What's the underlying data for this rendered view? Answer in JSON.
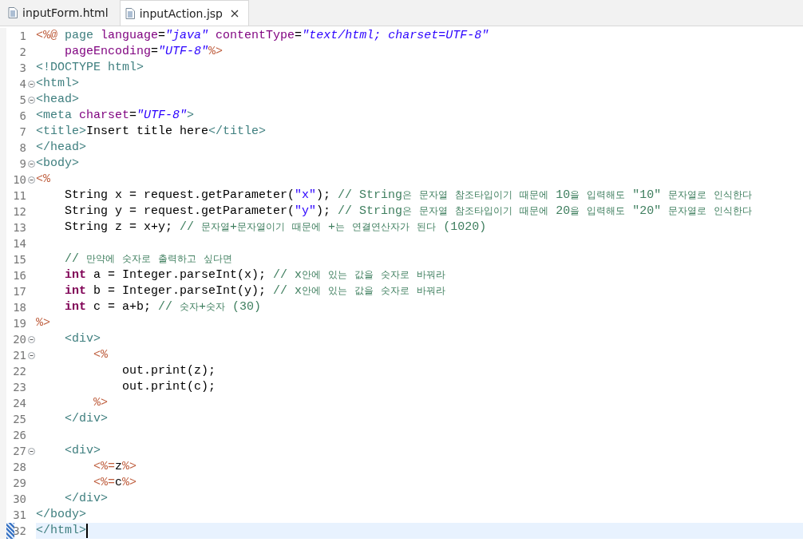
{
  "tabs": [
    {
      "label": "inputForm.html",
      "selected": false,
      "closable": false
    },
    {
      "label": "inputAction.jsp",
      "selected": true,
      "closable": true
    }
  ],
  "lines": [
    {
      "number": "1",
      "foldable": false,
      "current": false,
      "marked": false,
      "tokens": [
        {
          "kind": "jsp",
          "text": "<%@"
        },
        {
          "kind": "tag",
          "text": " page"
        },
        {
          "kind": "attr",
          "text": " language"
        },
        {
          "kind": "plain",
          "text": "="
        },
        {
          "kind": "value",
          "text": "\"java\""
        },
        {
          "kind": "attr",
          "text": " contentType"
        },
        {
          "kind": "plain",
          "text": "="
        },
        {
          "kind": "value",
          "text": "\"text/html; charset=UTF-8\""
        }
      ]
    },
    {
      "number": "2",
      "foldable": false,
      "current": false,
      "marked": false,
      "tokens": [
        {
          "kind": "attr",
          "text": "    pageEncoding"
        },
        {
          "kind": "plain",
          "text": "="
        },
        {
          "kind": "value",
          "text": "\"UTF-8\""
        },
        {
          "kind": "jsp",
          "text": "%>"
        }
      ]
    },
    {
      "number": "3",
      "foldable": false,
      "current": false,
      "marked": false,
      "tokens": [
        {
          "kind": "tag",
          "text": "<!DOCTYPE html>"
        }
      ]
    },
    {
      "number": "4",
      "foldable": true,
      "current": false,
      "marked": false,
      "tokens": [
        {
          "kind": "tag",
          "text": "<html>"
        }
      ]
    },
    {
      "number": "5",
      "foldable": true,
      "current": false,
      "marked": false,
      "tokens": [
        {
          "kind": "tag",
          "text": "<head>"
        }
      ]
    },
    {
      "number": "6",
      "foldable": false,
      "current": false,
      "marked": false,
      "tokens": [
        {
          "kind": "tag",
          "text": "<meta"
        },
        {
          "kind": "attr",
          "text": " charset"
        },
        {
          "kind": "plain",
          "text": "="
        },
        {
          "kind": "value",
          "text": "\"UTF-8\""
        },
        {
          "kind": "tag",
          "text": ">"
        }
      ]
    },
    {
      "number": "7",
      "foldable": false,
      "current": false,
      "marked": false,
      "tokens": [
        {
          "kind": "tag",
          "text": "<title>"
        },
        {
          "kind": "plain",
          "text": "Insert title here"
        },
        {
          "kind": "tag",
          "text": "</title>"
        }
      ]
    },
    {
      "number": "8",
      "foldable": false,
      "current": false,
      "marked": false,
      "tokens": [
        {
          "kind": "tag",
          "text": "</head>"
        }
      ]
    },
    {
      "number": "9",
      "foldable": true,
      "current": false,
      "marked": false,
      "tokens": [
        {
          "kind": "tag",
          "text": "<body>"
        }
      ]
    },
    {
      "number": "10",
      "foldable": true,
      "current": false,
      "marked": false,
      "tokens": [
        {
          "kind": "jsp",
          "text": "<%"
        }
      ]
    },
    {
      "number": "11",
      "foldable": false,
      "current": false,
      "marked": false,
      "tokens": [
        {
          "kind": "plain",
          "text": "    String x = request.getParameter("
        },
        {
          "kind": "string",
          "text": "\"x\""
        },
        {
          "kind": "plain",
          "text": "); "
        },
        {
          "kind": "comment",
          "text": "// String은 문자열 참조타입이기 때문에 10을 입력해도 \"10\" 문자열로 인식한다"
        }
      ]
    },
    {
      "number": "12",
      "foldable": false,
      "current": false,
      "marked": false,
      "tokens": [
        {
          "kind": "plain",
          "text": "    String y = request.getParameter("
        },
        {
          "kind": "string",
          "text": "\"y\""
        },
        {
          "kind": "plain",
          "text": "); "
        },
        {
          "kind": "comment",
          "text": "// String은 문자열 참조타입이기 때문에 20을 입력해도 \"20\" 문자열로 인식한다"
        }
      ]
    },
    {
      "number": "13",
      "foldable": false,
      "current": false,
      "marked": false,
      "tokens": [
        {
          "kind": "plain",
          "text": "    String z = x+y; "
        },
        {
          "kind": "comment",
          "text": "// 문자열+문자열이기 때문에 +는 연결연산자가 된다 (1020)"
        }
      ]
    },
    {
      "number": "14",
      "foldable": false,
      "current": false,
      "marked": false
    },
    {
      "number": "15",
      "foldable": false,
      "current": false,
      "marked": false,
      "tokens": [
        {
          "kind": "comment",
          "text": "    // 만약에 숫자로 출력하고 싶다면"
        }
      ]
    },
    {
      "number": "16",
      "foldable": false,
      "current": false,
      "marked": false,
      "tokens": [
        {
          "kind": "keyword",
          "text": "    int"
        },
        {
          "kind": "plain",
          "text": " a = Integer.parseInt(x); "
        },
        {
          "kind": "comment",
          "text": "// x안에 있는 값을 숫자로 바꿔라"
        }
      ]
    },
    {
      "number": "17",
      "foldable": false,
      "current": false,
      "marked": false,
      "tokens": [
        {
          "kind": "keyword",
          "text": "    int"
        },
        {
          "kind": "plain",
          "text": " b = Integer.parseInt(y); "
        },
        {
          "kind": "comment",
          "text": "// x안에 있는 값을 숫자로 바꿔라"
        }
      ]
    },
    {
      "number": "18",
      "foldable": false,
      "current": false,
      "marked": false,
      "tokens": [
        {
          "kind": "keyword",
          "text": "    int"
        },
        {
          "kind": "plain",
          "text": " c = a+b; "
        },
        {
          "kind": "comment",
          "text": "// 숫자+숫자 (30)"
        }
      ]
    },
    {
      "number": "19",
      "foldable": false,
      "current": false,
      "marked": false,
      "tokens": [
        {
          "kind": "jsp",
          "text": "%>"
        }
      ]
    },
    {
      "number": "20",
      "foldable": true,
      "current": false,
      "marked": false,
      "tokens": [
        {
          "kind": "tag",
          "text": "    <div>"
        }
      ]
    },
    {
      "number": "21",
      "foldable": true,
      "current": false,
      "marked": false,
      "tokens": [
        {
          "kind": "jsp",
          "text": "        <%"
        }
      ]
    },
    {
      "number": "22",
      "foldable": false,
      "current": false,
      "marked": false,
      "tokens": [
        {
          "kind": "plain",
          "text": "            out.print(z);"
        }
      ]
    },
    {
      "number": "23",
      "foldable": false,
      "current": false,
      "marked": false,
      "tokens": [
        {
          "kind": "plain",
          "text": "            out.print(c);"
        }
      ]
    },
    {
      "number": "24",
      "foldable": false,
      "current": false,
      "marked": false,
      "tokens": [
        {
          "kind": "jsp",
          "text": "        %>"
        }
      ]
    },
    {
      "number": "25",
      "foldable": false,
      "current": false,
      "marked": false,
      "tokens": [
        {
          "kind": "tag",
          "text": "    </div>"
        }
      ]
    },
    {
      "number": "26",
      "foldable": false,
      "current": false,
      "marked": false
    },
    {
      "number": "27",
      "foldable": true,
      "current": false,
      "marked": false,
      "tokens": [
        {
          "kind": "tag",
          "text": "    <div>"
        }
      ]
    },
    {
      "number": "28",
      "foldable": false,
      "current": false,
      "marked": false,
      "tokens": [
        {
          "kind": "jsp",
          "text": "        <%="
        },
        {
          "kind": "plain",
          "text": "z"
        },
        {
          "kind": "jsp",
          "text": "%>"
        }
      ]
    },
    {
      "number": "29",
      "foldable": false,
      "current": false,
      "marked": false,
      "tokens": [
        {
          "kind": "jsp",
          "text": "        <%="
        },
        {
          "kind": "plain",
          "text": "c"
        },
        {
          "kind": "jsp",
          "text": "%>"
        }
      ]
    },
    {
      "number": "30",
      "foldable": false,
      "current": false,
      "marked": false,
      "tokens": [
        {
          "kind": "tag",
          "text": "    </div>"
        }
      ]
    },
    {
      "number": "31",
      "foldable": false,
      "current": false,
      "marked": false,
      "tokens": [
        {
          "kind": "tag",
          "text": "</body>"
        }
      ]
    },
    {
      "number": "32",
      "foldable": false,
      "current": true,
      "marked": true,
      "tokens": [
        {
          "kind": "tag",
          "text": "</html>"
        }
      ]
    }
  ]
}
